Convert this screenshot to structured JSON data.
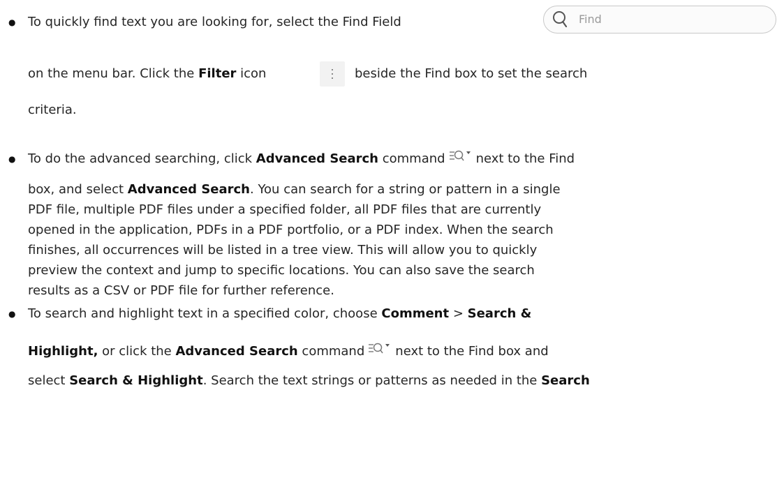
{
  "find_field": {
    "placeholder": "Find"
  },
  "bullet1": {
    "line1": "To quickly find text you are looking for, select the Find Field",
    "line2_a": "on the menu bar. Click the ",
    "filter_bold": "Filter",
    "line2_b": " icon",
    "line2_c": "beside the Find box to set the search",
    "line3": "criteria."
  },
  "bullet2": {
    "a": "To do the advanced searching, click ",
    "adv_bold": "Advanced Search",
    "b": " command",
    "c": "next to the Find",
    "line2_a": "box, and select ",
    "adv_bold2": "Advanced Search",
    "line2_b": ". You can search for a string or pattern in a single",
    "line3": "PDF file, multiple PDF files under a specified folder, all PDF files that are currently",
    "line4": "opened in the application, PDFs in a PDF portfolio, or a PDF index. When the search",
    "line5": "finishes, all occurrences will be listed in a tree view. This will allow you to quickly",
    "line6": "preview the context and jump to specific locations. You can also save the search",
    "line7": "results as a CSV or PDF file for further reference."
  },
  "bullet3": {
    "a": "To search and highlight text in a specified color, choose ",
    "comment_bold": "Comment",
    "gt1": " > ",
    "sh_bold": "Search &",
    "line2_sh_bold": "Highlight,",
    "line2_a": " or click the ",
    "adv_bold": "Advanced Search",
    "line2_b": " command",
    "line2_c": "next to the Find box and",
    "line3_a": "select ",
    "sh_bold2": "Search & Highlight",
    "line3_b": ". Search the text strings or patterns as needed in the ",
    "search_bold": "Search"
  }
}
